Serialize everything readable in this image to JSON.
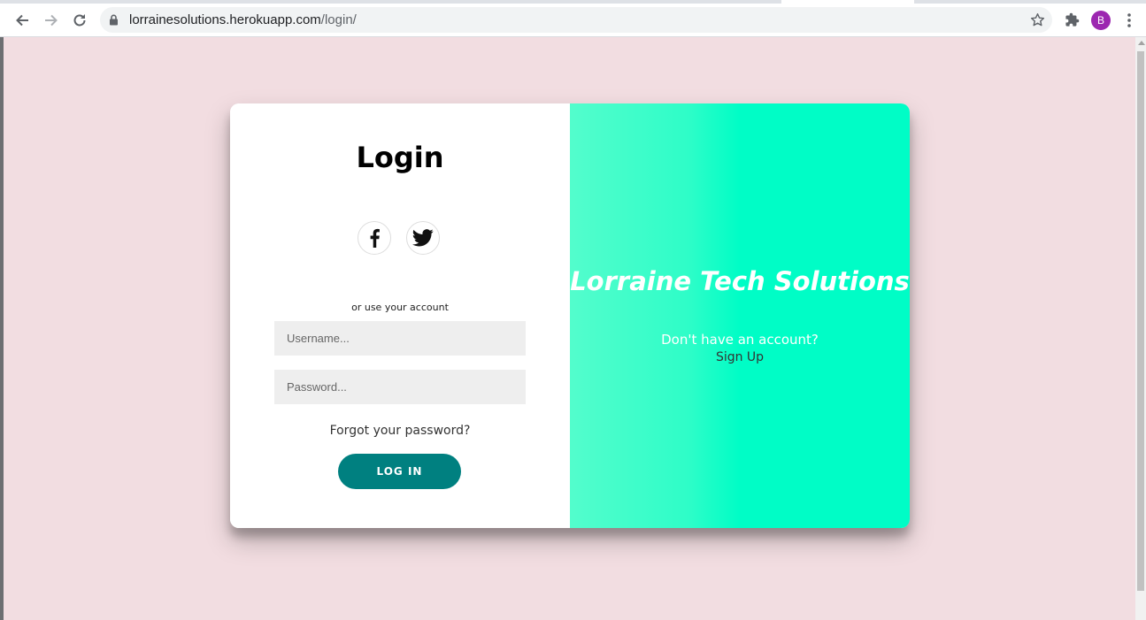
{
  "browser": {
    "url_host": "lorrainesolutions.herokuapp.com",
    "url_path": "/login/",
    "profile_initial": "B",
    "icons": {
      "back": "back-arrow-icon",
      "forward": "forward-arrow-icon",
      "reload": "reload-icon",
      "lock": "lock-icon",
      "bookmark": "star-icon",
      "extensions": "puzzle-icon",
      "menu": "kebab-menu-icon"
    },
    "colors": {
      "avatar": "#9c27b0"
    }
  },
  "login": {
    "title": "Login",
    "social": [
      "facebook-icon",
      "twitter-icon"
    ],
    "or_text": "or use your account",
    "username_placeholder": "Username...",
    "password_placeholder": "Password...",
    "forgot_password": "Forgot your password?",
    "login_button": "Log In"
  },
  "promo": {
    "brand": "Lorraine Tech Solutions",
    "no_account": "Don't have an account?",
    "signup_link": "Sign Up"
  },
  "colors": {
    "page_background": "#f2dde1",
    "button": "#008080",
    "panel_gradient_start": "#53fdcc",
    "panel_gradient_end": "#00fdc6"
  }
}
